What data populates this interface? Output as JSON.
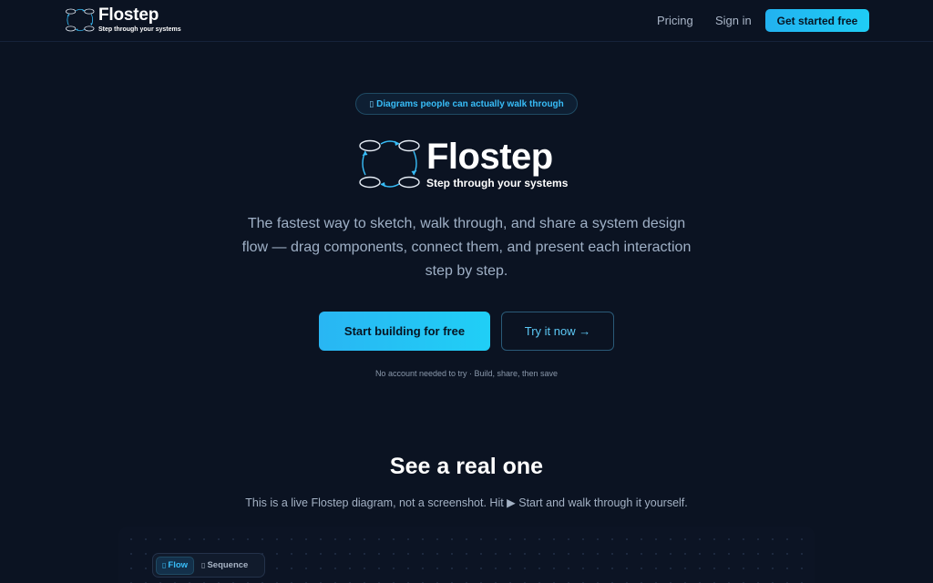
{
  "nav": {
    "brand_name": "Flostep",
    "brand_tagline": "Step through your systems",
    "pricing": "Pricing",
    "sign_in": "Sign in",
    "cta": "Get started free"
  },
  "hero": {
    "pill_icon": "▯",
    "pill_label": "Diagrams people can actually walk through",
    "logo_name": "Flostep",
    "logo_tagline": "Step through your systems",
    "description": "The fastest way to sketch, walk through, and share a system design flow — drag components, connect them, and present each interaction step by step.",
    "primary_cta": "Start building for free",
    "secondary_cta": "Try it now →",
    "note": "No account needed to try · Build, share, then save"
  },
  "showcase": {
    "title": "See a real one",
    "subtitle": "This is a live Flostep diagram, not a screenshot. Hit ▶ Start and walk through it yourself.",
    "tabs": [
      {
        "icon": "▯",
        "label": "Flow"
      },
      {
        "icon": "▯",
        "label": "Sequence"
      }
    ]
  },
  "colors": {
    "background": "#0b1322",
    "accent": "#22b8f2",
    "text_muted": "#9fb0c6"
  },
  "icons": {
    "logo": "cycle-diagram-icon"
  }
}
